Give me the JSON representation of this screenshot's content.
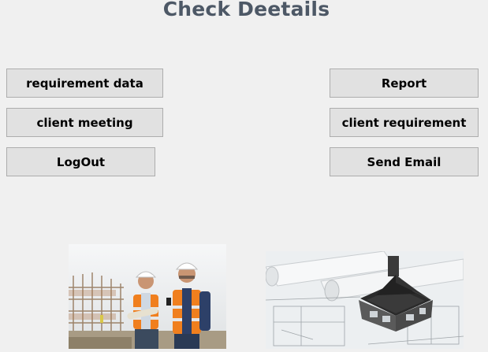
{
  "window": {
    "title": "Check Deetails"
  },
  "buttons": {
    "requirement_data": "requirement data",
    "client_meeting": "client meeting",
    "logout": "LogOut",
    "report": "Report",
    "client_requirement": "client requirement",
    "send_email": "Send Email"
  },
  "images": {
    "left": "engineers-photo",
    "right": "house-blueprint-photo"
  },
  "colors": {
    "background": "#f0f0f0",
    "title": "#4d5866",
    "button_face": "#e1e1e1",
    "button_border": "#adadad"
  }
}
